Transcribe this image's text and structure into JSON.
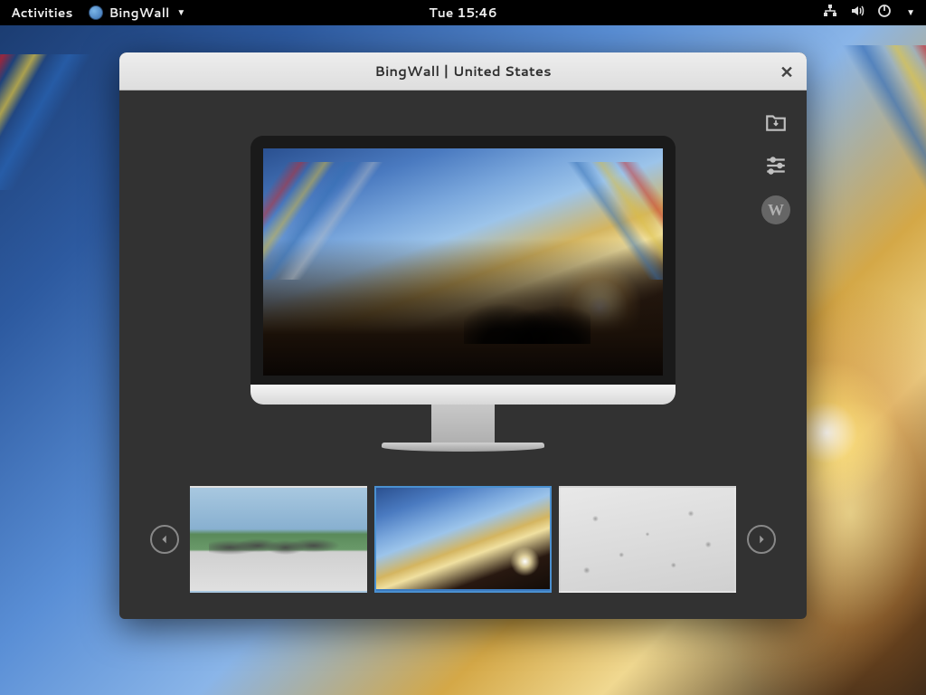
{
  "topbar": {
    "activities": "Activities",
    "app_name": "BingWall",
    "clock": "Tue 15:46"
  },
  "window": {
    "title": "BingWall | United States"
  },
  "toolbar": {
    "download": "download",
    "settings": "settings",
    "wiki": "W"
  },
  "carousel": {
    "selected_index": 1,
    "thumbnails": [
      {
        "name": "statue-band"
      },
      {
        "name": "prayer-flags"
      },
      {
        "name": "snow-field"
      }
    ]
  }
}
